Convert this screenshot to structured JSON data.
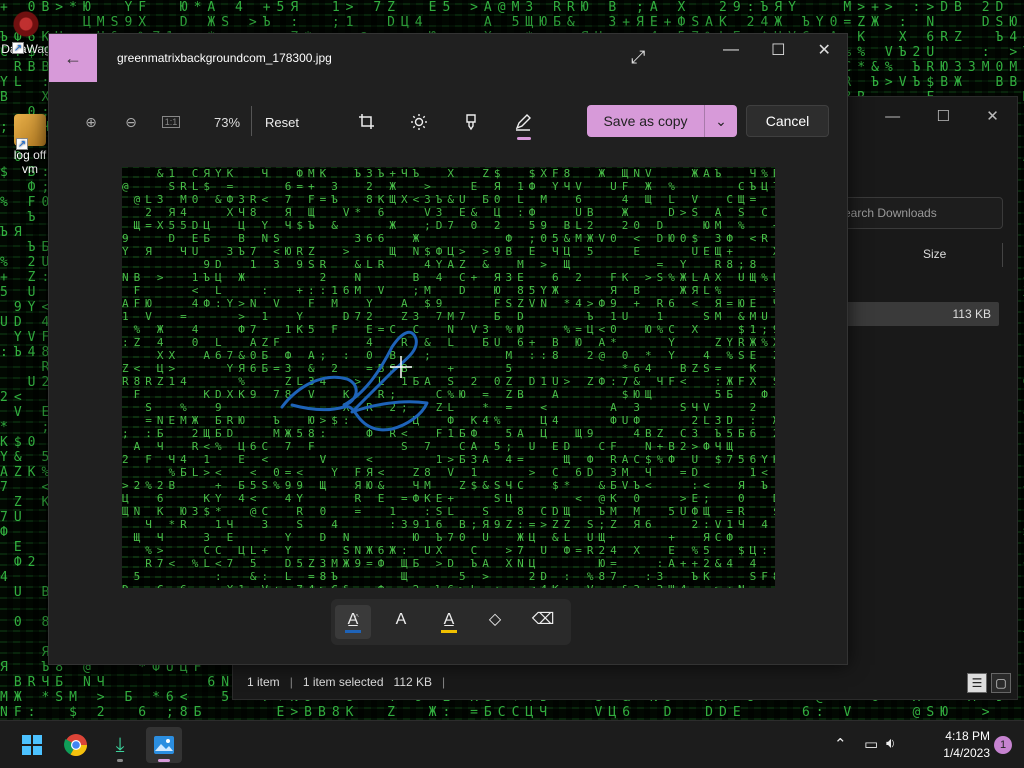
{
  "desktop": {
    "icons": [
      {
        "label": "DataWag"
      },
      {
        "label": "log off\nvm"
      }
    ]
  },
  "explorer": {
    "search_placeholder": "earch Downloads",
    "size_header": "Size",
    "file_size": "113 KB",
    "status": {
      "item_count": "1 item",
      "selected": "1 item selected",
      "selected_size": "112 KB"
    }
  },
  "photos": {
    "title": "greenmatrixbackgroundcom_178300.jpg",
    "zoom_level": "73%",
    "reset_label": "Reset",
    "save_label": "Save as copy",
    "cancel_label": "Cancel",
    "accent": "#d79ad9",
    "ink_color": "#1e63b8",
    "draw_tools": [
      {
        "name": "ballpoint-pen",
        "color": "#1e63b8",
        "selected": true
      },
      {
        "name": "pencil",
        "color": "#ffffff",
        "selected": false
      },
      {
        "name": "highlighter",
        "color": "#f0c000",
        "selected": false
      },
      {
        "name": "eraser",
        "selected": false
      },
      {
        "name": "clear-all",
        "selected": false
      }
    ]
  },
  "taskbar": {
    "time": "4:18 PM",
    "date": "1/4/2023",
    "notification_count": "1"
  }
}
